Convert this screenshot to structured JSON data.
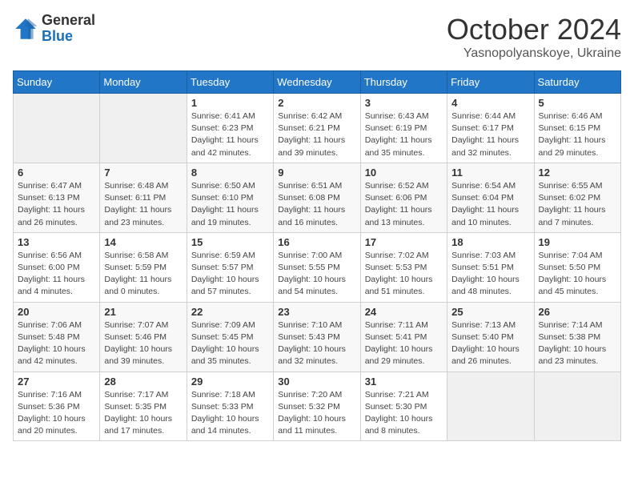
{
  "header": {
    "logo": {
      "general": "General",
      "blue": "Blue"
    },
    "title": "October 2024",
    "location": "Yasnopolyanskoye, Ukraine"
  },
  "weekdays": [
    "Sunday",
    "Monday",
    "Tuesday",
    "Wednesday",
    "Thursday",
    "Friday",
    "Saturday"
  ],
  "weeks": [
    [
      {
        "day": "",
        "empty": true
      },
      {
        "day": "",
        "empty": true
      },
      {
        "day": "1",
        "sunrise": "6:41 AM",
        "sunset": "6:23 PM",
        "daylight": "11 hours and 42 minutes."
      },
      {
        "day": "2",
        "sunrise": "6:42 AM",
        "sunset": "6:21 PM",
        "daylight": "11 hours and 39 minutes."
      },
      {
        "day": "3",
        "sunrise": "6:43 AM",
        "sunset": "6:19 PM",
        "daylight": "11 hours and 35 minutes."
      },
      {
        "day": "4",
        "sunrise": "6:44 AM",
        "sunset": "6:17 PM",
        "daylight": "11 hours and 32 minutes."
      },
      {
        "day": "5",
        "sunrise": "6:46 AM",
        "sunset": "6:15 PM",
        "daylight": "11 hours and 29 minutes."
      }
    ],
    [
      {
        "day": "6",
        "sunrise": "6:47 AM",
        "sunset": "6:13 PM",
        "daylight": "11 hours and 26 minutes."
      },
      {
        "day": "7",
        "sunrise": "6:48 AM",
        "sunset": "6:11 PM",
        "daylight": "11 hours and 23 minutes."
      },
      {
        "day": "8",
        "sunrise": "6:50 AM",
        "sunset": "6:10 PM",
        "daylight": "11 hours and 19 minutes."
      },
      {
        "day": "9",
        "sunrise": "6:51 AM",
        "sunset": "6:08 PM",
        "daylight": "11 hours and 16 minutes."
      },
      {
        "day": "10",
        "sunrise": "6:52 AM",
        "sunset": "6:06 PM",
        "daylight": "11 hours and 13 minutes."
      },
      {
        "day": "11",
        "sunrise": "6:54 AM",
        "sunset": "6:04 PM",
        "daylight": "11 hours and 10 minutes."
      },
      {
        "day": "12",
        "sunrise": "6:55 AM",
        "sunset": "6:02 PM",
        "daylight": "11 hours and 7 minutes."
      }
    ],
    [
      {
        "day": "13",
        "sunrise": "6:56 AM",
        "sunset": "6:00 PM",
        "daylight": "11 hours and 4 minutes."
      },
      {
        "day": "14",
        "sunrise": "6:58 AM",
        "sunset": "5:59 PM",
        "daylight": "11 hours and 0 minutes."
      },
      {
        "day": "15",
        "sunrise": "6:59 AM",
        "sunset": "5:57 PM",
        "daylight": "10 hours and 57 minutes."
      },
      {
        "day": "16",
        "sunrise": "7:00 AM",
        "sunset": "5:55 PM",
        "daylight": "10 hours and 54 minutes."
      },
      {
        "day": "17",
        "sunrise": "7:02 AM",
        "sunset": "5:53 PM",
        "daylight": "10 hours and 51 minutes."
      },
      {
        "day": "18",
        "sunrise": "7:03 AM",
        "sunset": "5:51 PM",
        "daylight": "10 hours and 48 minutes."
      },
      {
        "day": "19",
        "sunrise": "7:04 AM",
        "sunset": "5:50 PM",
        "daylight": "10 hours and 45 minutes."
      }
    ],
    [
      {
        "day": "20",
        "sunrise": "7:06 AM",
        "sunset": "5:48 PM",
        "daylight": "10 hours and 42 minutes."
      },
      {
        "day": "21",
        "sunrise": "7:07 AM",
        "sunset": "5:46 PM",
        "daylight": "10 hours and 39 minutes."
      },
      {
        "day": "22",
        "sunrise": "7:09 AM",
        "sunset": "5:45 PM",
        "daylight": "10 hours and 35 minutes."
      },
      {
        "day": "23",
        "sunrise": "7:10 AM",
        "sunset": "5:43 PM",
        "daylight": "10 hours and 32 minutes."
      },
      {
        "day": "24",
        "sunrise": "7:11 AM",
        "sunset": "5:41 PM",
        "daylight": "10 hours and 29 minutes."
      },
      {
        "day": "25",
        "sunrise": "7:13 AM",
        "sunset": "5:40 PM",
        "daylight": "10 hours and 26 minutes."
      },
      {
        "day": "26",
        "sunrise": "7:14 AM",
        "sunset": "5:38 PM",
        "daylight": "10 hours and 23 minutes."
      }
    ],
    [
      {
        "day": "27",
        "sunrise": "7:16 AM",
        "sunset": "5:36 PM",
        "daylight": "10 hours and 20 minutes."
      },
      {
        "day": "28",
        "sunrise": "7:17 AM",
        "sunset": "5:35 PM",
        "daylight": "10 hours and 17 minutes."
      },
      {
        "day": "29",
        "sunrise": "7:18 AM",
        "sunset": "5:33 PM",
        "daylight": "10 hours and 14 minutes."
      },
      {
        "day": "30",
        "sunrise": "7:20 AM",
        "sunset": "5:32 PM",
        "daylight": "10 hours and 11 minutes."
      },
      {
        "day": "31",
        "sunrise": "7:21 AM",
        "sunset": "5:30 PM",
        "daylight": "10 hours and 8 minutes."
      },
      {
        "day": "",
        "empty": true
      },
      {
        "day": "",
        "empty": true
      }
    ]
  ],
  "labels": {
    "sunrise": "Sunrise:",
    "sunset": "Sunset:",
    "daylight": "Daylight:"
  }
}
